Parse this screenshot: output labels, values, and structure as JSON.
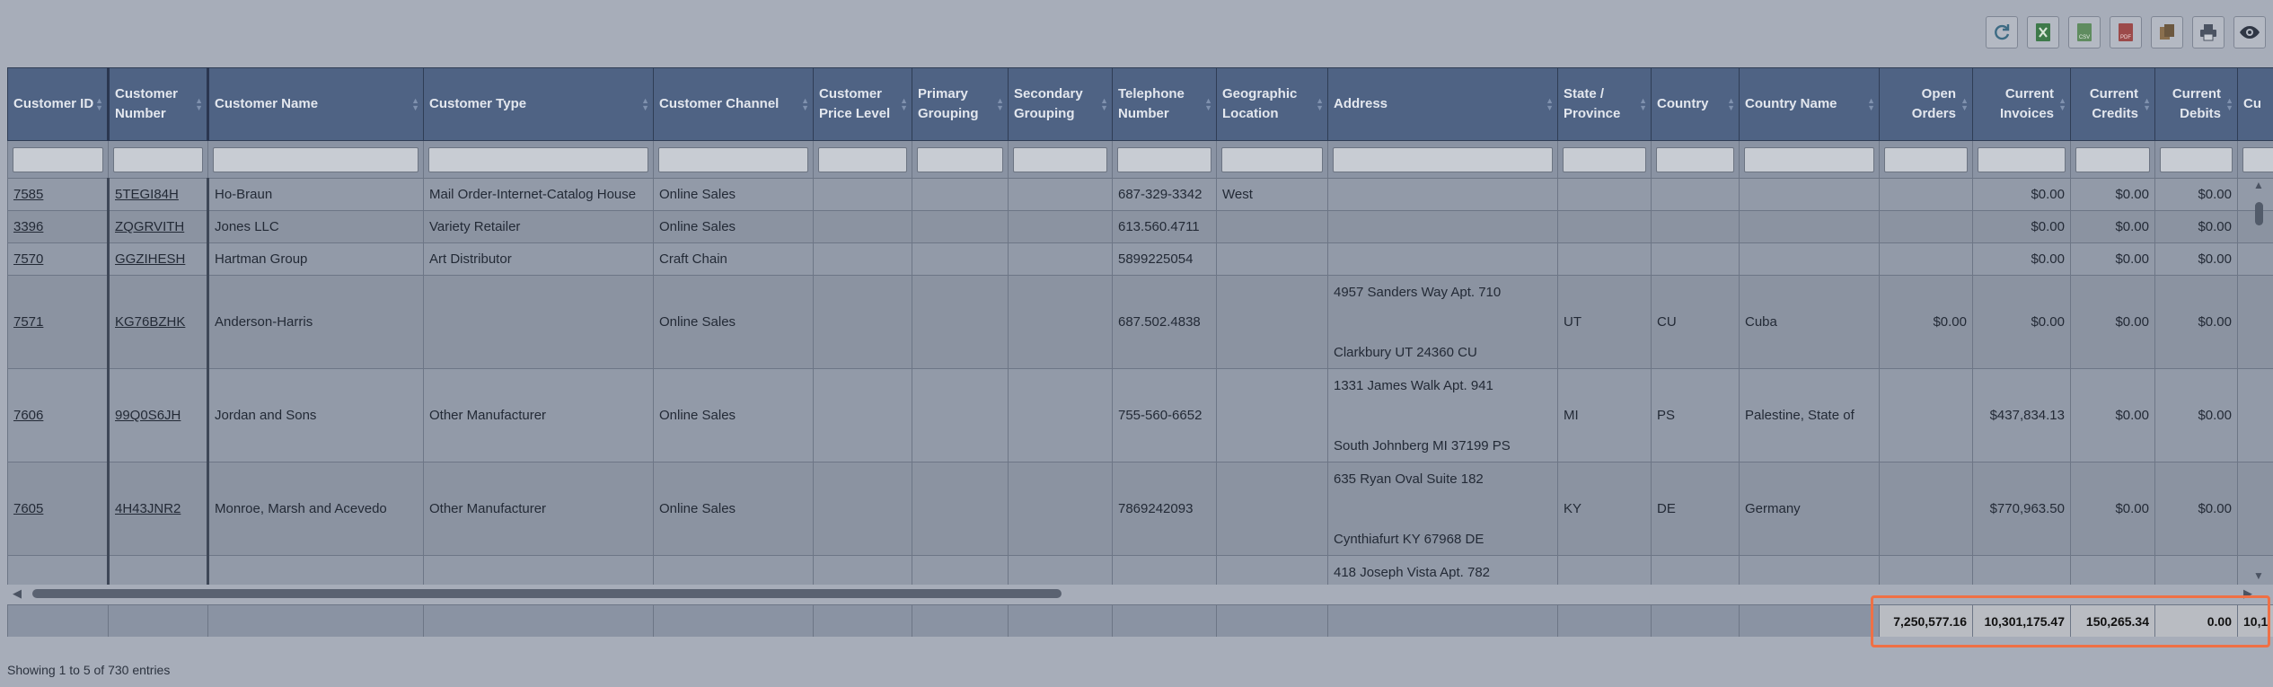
{
  "toolbar": {
    "buttons": [
      {
        "icon": "refresh-icon"
      },
      {
        "icon": "excel-icon"
      },
      {
        "icon": "csv-icon",
        "label": "CSV"
      },
      {
        "icon": "pdf-icon",
        "label": "PDF"
      },
      {
        "icon": "copy-icon"
      },
      {
        "icon": "print-icon"
      },
      {
        "icon": "eye-icon"
      }
    ]
  },
  "columns": {
    "customer_id": "Customer ID",
    "customer_number": "Customer Number",
    "customer_name": "Customer Name",
    "customer_type": "Customer Type",
    "customer_channel": "Customer Channel",
    "customer_price_level": "Customer Price Level",
    "primary_grouping": "Primary Grouping",
    "secondary_grouping": "Secondary Grouping",
    "telephone_number": "Telephone Number",
    "geographic_location": "Geographic Location",
    "address": "Address",
    "state_province": "State / Province",
    "country": "Country",
    "country_name": "Country Name",
    "open_orders": "Open Orders",
    "current_invoices": "Current Invoices",
    "current_credits": "Current Credits",
    "current_debits": "Current Debits",
    "next": "Cu"
  },
  "rows": [
    {
      "id": "7585",
      "number": "5TEGI84H",
      "name": "Ho-Braun",
      "type": "Mail Order-Internet-Catalog House",
      "channel": "Online Sales",
      "phone": "687-329-3342",
      "geo": "West",
      "addr1": "",
      "addr2": "",
      "state": "",
      "country": "",
      "country_name": "",
      "open_orders": "",
      "invoices": "$0.00",
      "credits": "$0.00",
      "debits": "$0.00"
    },
    {
      "id": "3396",
      "number": "ZQGRVITH",
      "name": "Jones LLC",
      "type": "Variety Retailer",
      "channel": "Online Sales",
      "phone": "613.560.4711",
      "geo": "",
      "addr1": "",
      "addr2": "",
      "state": "",
      "country": "",
      "country_name": "",
      "open_orders": "",
      "invoices": "$0.00",
      "credits": "$0.00",
      "debits": "$0.00"
    },
    {
      "id": "7570",
      "number": "GGZIHESH",
      "name": "Hartman Group",
      "type": "Art Distributor",
      "channel": "Craft Chain",
      "phone": "5899225054",
      "geo": "",
      "addr1": "",
      "addr2": "",
      "state": "",
      "country": "",
      "country_name": "",
      "open_orders": "",
      "invoices": "$0.00",
      "credits": "$0.00",
      "debits": "$0.00"
    },
    {
      "id": "7571",
      "number": "KG76BZHK",
      "name": "Anderson-Harris",
      "type": "",
      "channel": "Online Sales",
      "phone": "687.502.4838",
      "geo": "",
      "addr1": "4957 Sanders Way Apt. 710",
      "addr2": "Clarkbury UT 24360 CU",
      "state": "UT",
      "country": "CU",
      "country_name": "Cuba",
      "open_orders": "$0.00",
      "invoices": "$0.00",
      "credits": "$0.00",
      "debits": "$0.00"
    },
    {
      "id": "7606",
      "number": "99Q0S6JH",
      "name": "Jordan and Sons",
      "type": "Other Manufacturer",
      "channel": "Online Sales",
      "phone": "755-560-6652",
      "geo": "",
      "addr1": "1331 James Walk Apt. 941",
      "addr2": "South Johnberg MI 37199 PS",
      "state": "MI",
      "country": "PS",
      "country_name": "Palestine, State of",
      "open_orders": "",
      "invoices": "$437,834.13",
      "credits": "$0.00",
      "debits": "$0.00"
    },
    {
      "id": "7605",
      "number": "4H43JNR2",
      "name": "Monroe, Marsh and Acevedo",
      "type": "Other Manufacturer",
      "channel": "Online Sales",
      "phone": "7869242093",
      "geo": "",
      "addr1": "635 Ryan Oval Suite 182",
      "addr2": "Cynthiafurt KY 67968 DE",
      "state": "KY",
      "country": "DE",
      "country_name": "Germany",
      "open_orders": "",
      "invoices": "$770,963.50",
      "credits": "$0.00",
      "debits": "$0.00"
    },
    {
      "id": "",
      "number": "",
      "name": "",
      "type": "",
      "channel": "",
      "phone": "",
      "geo": "",
      "addr1": "418 Joseph Vista Apt. 782",
      "addr2": "",
      "state": "",
      "country": "",
      "country_name": "",
      "open_orders": "",
      "invoices": "",
      "credits": "",
      "debits": ""
    }
  ],
  "totals": {
    "open_orders": "7,250,577.16",
    "current_invoices": "10,301,175.47",
    "current_credits": "150,265.34",
    "current_debits": "0.00",
    "next": "10,1"
  },
  "info": "Showing 1 to 5 of 730 entries",
  "colors": {
    "header_bg": "#4f6384",
    "highlight": "#ef7045",
    "overlay_bg": "#a7adb9"
  }
}
